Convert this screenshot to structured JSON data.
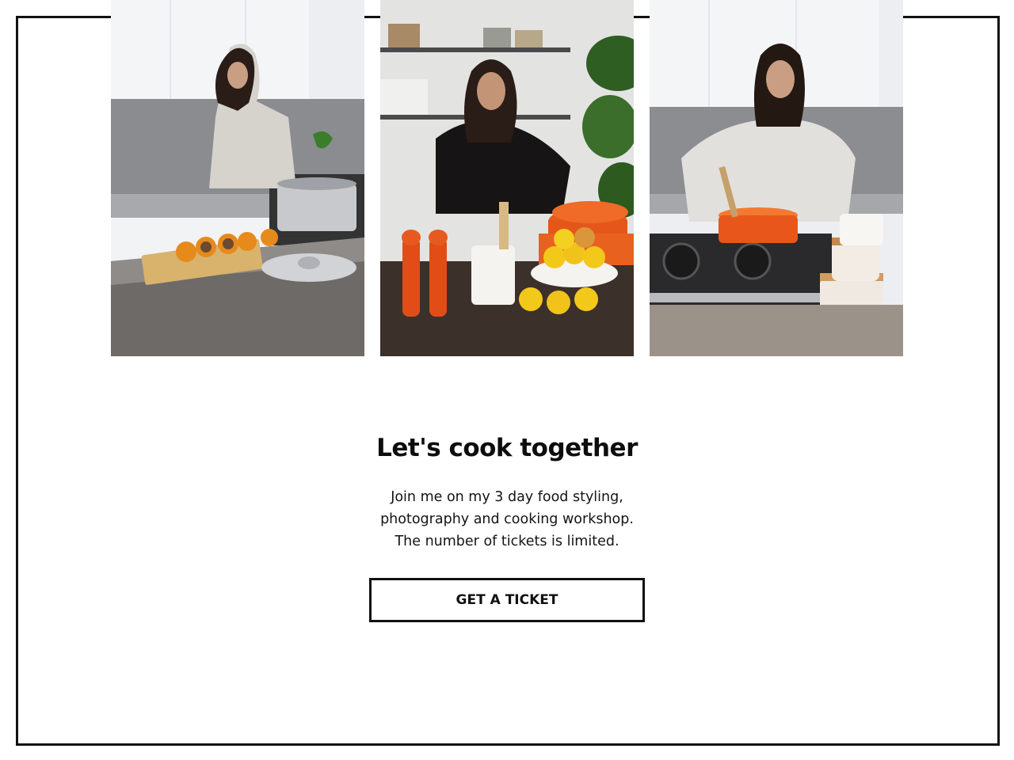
{
  "photos": [
    {
      "alt_icon": "cooking-photo-1"
    },
    {
      "alt_icon": "cooking-photo-2"
    },
    {
      "alt_icon": "cooking-photo-3"
    }
  ],
  "section": {
    "title": "Let's cook together",
    "description_lines": [
      "Join me on my 3 day food styling,",
      "photography and cooking workshop.",
      "The number of tickets is limited."
    ],
    "cta_label": "GET A TICKET"
  },
  "colors": {
    "frame_border": "#111111",
    "accent_orange": "#e8561c",
    "lemon": "#f2c81b"
  }
}
